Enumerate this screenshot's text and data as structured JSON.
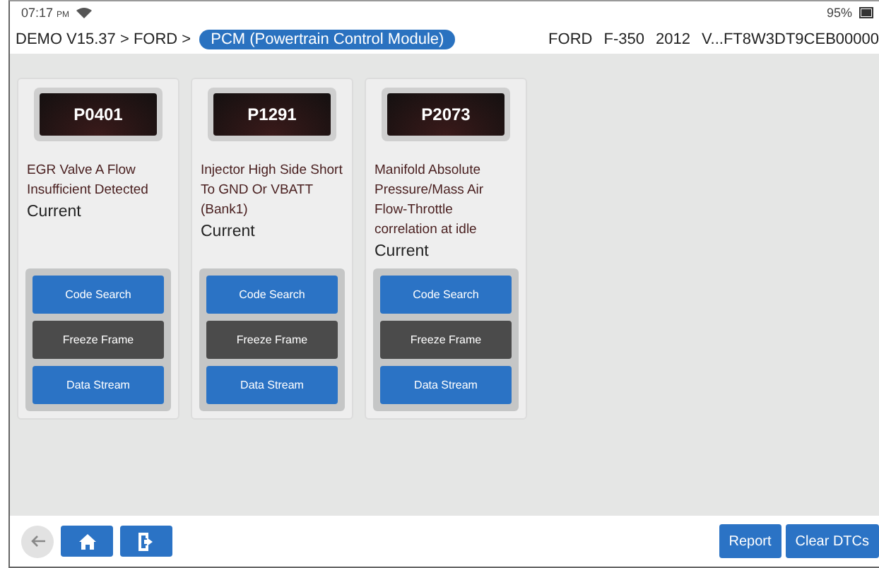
{
  "status_bar": {
    "time": "07:17",
    "ampm": "PM",
    "battery": "95%"
  },
  "header": {
    "breadcrumb": "DEMO V15.37 > FORD >",
    "module": "PCM (Powertrain Control Module)",
    "vehicle": [
      "FORD",
      "F-350",
      "2012",
      "V...FT8W3DT9CEB00000"
    ]
  },
  "dtcs": [
    {
      "code": "P0401",
      "description": "EGR Valve A Flow Insufficient Detected",
      "status": "Current",
      "buttons": [
        {
          "label": "Code Search",
          "kind": "primary"
        },
        {
          "label": "Freeze Frame",
          "kind": "dark"
        },
        {
          "label": "Data Stream",
          "kind": "primary"
        }
      ]
    },
    {
      "code": "P1291",
      "description": "Injector High Side Short To GND Or VBATT (Bank1)",
      "status": "Current",
      "buttons": [
        {
          "label": "Code Search",
          "kind": "primary"
        },
        {
          "label": "Freeze Frame",
          "kind": "dark"
        },
        {
          "label": "Data Stream",
          "kind": "primary"
        }
      ]
    },
    {
      "code": "P2073",
      "description": "Manifold Absolute Pressure/Mass Air Flow-Throttle correlation at idle",
      "status": "Current",
      "buttons": [
        {
          "label": "Code Search",
          "kind": "primary"
        },
        {
          "label": "Freeze Frame",
          "kind": "dark"
        },
        {
          "label": "Data Stream",
          "kind": "primary"
        }
      ]
    }
  ],
  "footer": {
    "back_disabled": true,
    "buttons": [
      "Report",
      "Clear DTCs"
    ]
  }
}
